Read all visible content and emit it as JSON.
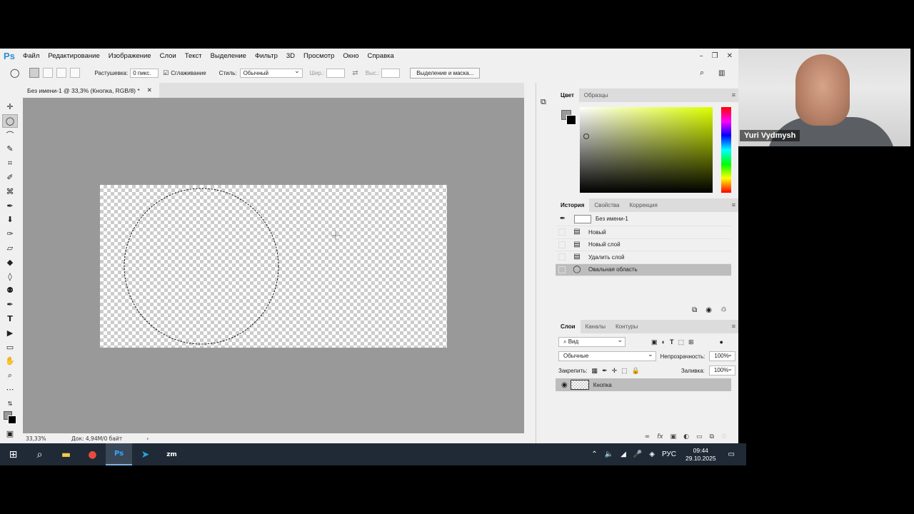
{
  "app": {
    "logo": "Ps"
  },
  "menu": [
    "Файл",
    "Редактирование",
    "Изображение",
    "Слои",
    "Текст",
    "Выделение",
    "Фильтр",
    "3D",
    "Просмотр",
    "Окно",
    "Справка"
  ],
  "options": {
    "feather_label": "Растушевка:",
    "feather_value": "0 пикс.",
    "antialias_label": "Сглаживание",
    "style_label": "Стиль:",
    "style_value": "Обычный",
    "width_label": "Шир.:",
    "height_label": "Выс.:",
    "select_mask_button": "Выделение и маска..."
  },
  "document": {
    "tab_title": "Без имени-1 @ 33,3% (Кнопка, RGB/8) *"
  },
  "status": {
    "zoom": "33,33%",
    "doc": "Док: 4,94M/0 байт"
  },
  "color_panel": {
    "tabs": [
      "Цвет",
      "Образцы"
    ],
    "fg": "#999999",
    "bg": "#000000",
    "hue": "#ddff00"
  },
  "history_panel": {
    "tabs": [
      "История",
      "Свойства",
      "Коррекция"
    ],
    "snapshot": "Без имени-1",
    "items": [
      "Новый",
      "Новый слой",
      "Удалить слой",
      "Овальная область"
    ],
    "selected_index": 3
  },
  "layers_panel": {
    "tabs": [
      "Слои",
      "Каналы",
      "Контуры"
    ],
    "filter": "Вид",
    "blend_mode": "Обычные",
    "opacity_label": "Непрозрачность:",
    "opacity_value": "100%",
    "lock_label": "Закрепить:",
    "fill_label": "Заливка:",
    "fill_value": "100%",
    "layer_name": "Кнопка"
  },
  "taskbar": {
    "lang": "РУС",
    "time": "09:44",
    "date": "29.10.2025"
  },
  "webcam": {
    "name": "Yuri Vydmysh"
  }
}
